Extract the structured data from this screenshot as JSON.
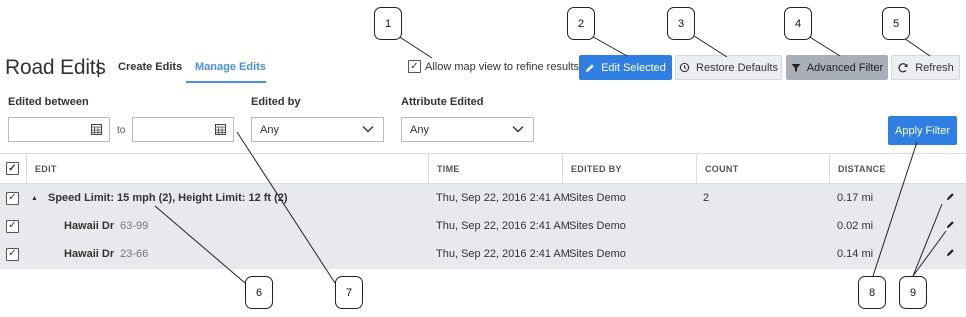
{
  "header": {
    "title": "Road Edits",
    "separator": "|",
    "tabs": [
      {
        "label": "Create Edits",
        "active": false
      },
      {
        "label": "Manage Edits",
        "active": true
      }
    ]
  },
  "toolbar": {
    "map_view_checkbox_label": "Allow map view to refine results",
    "map_view_checked": true,
    "edit_selected_label": "Edit Selected",
    "restore_defaults_label": "Restore Defaults",
    "advanced_filter_label": "Advanced Filter",
    "refresh_label": "Refresh"
  },
  "filters": {
    "edited_between_label": "Edited between",
    "to_label": "to",
    "date_from_value": "",
    "date_to_value": "",
    "edited_by_label": "Edited by",
    "edited_by_value": "Any",
    "attribute_edited_label": "Attribute Edited",
    "attribute_edited_value": "Any",
    "apply_filter_label": "Apply Filter"
  },
  "table": {
    "columns": [
      "EDIT",
      "TIME",
      "EDITED BY",
      "COUNT",
      "DISTANCE"
    ],
    "group": {
      "label": "Speed Limit: 15 mph (2), Height Limit: 12 ft (2)",
      "time": "Thu, Sep 22, 2016 2:41 AM",
      "edited_by": "Sites Demo",
      "count": "2",
      "distance": "0.17 mi"
    },
    "rows": [
      {
        "road": "Hawaii Dr",
        "range": "63-99",
        "time": "Thu, Sep 22, 2016 2:41 AM",
        "edited_by": "Sites Demo",
        "distance": "0.02 mi"
      },
      {
        "road": "Hawaii Dr",
        "range": "23-66",
        "time": "Thu, Sep 22, 2016 2:41 AM",
        "edited_by": "Sites Demo",
        "distance": "0.14 mi"
      }
    ]
  },
  "callouts": [
    "1",
    "2",
    "3",
    "4",
    "5",
    "6",
    "7",
    "8",
    "9"
  ],
  "colors": {
    "accent": "#2f7fe3",
    "tab_active": "#4a90e2",
    "row_bg": "#e8e9ec",
    "advanced_filter_bg": "#a9afb8"
  },
  "icons": [
    "checkbox-icon",
    "pencil-icon",
    "history-icon",
    "filter-icon",
    "refresh-icon",
    "calendar-icon",
    "chevron-down-icon",
    "collapse-triangle-icon"
  ]
}
